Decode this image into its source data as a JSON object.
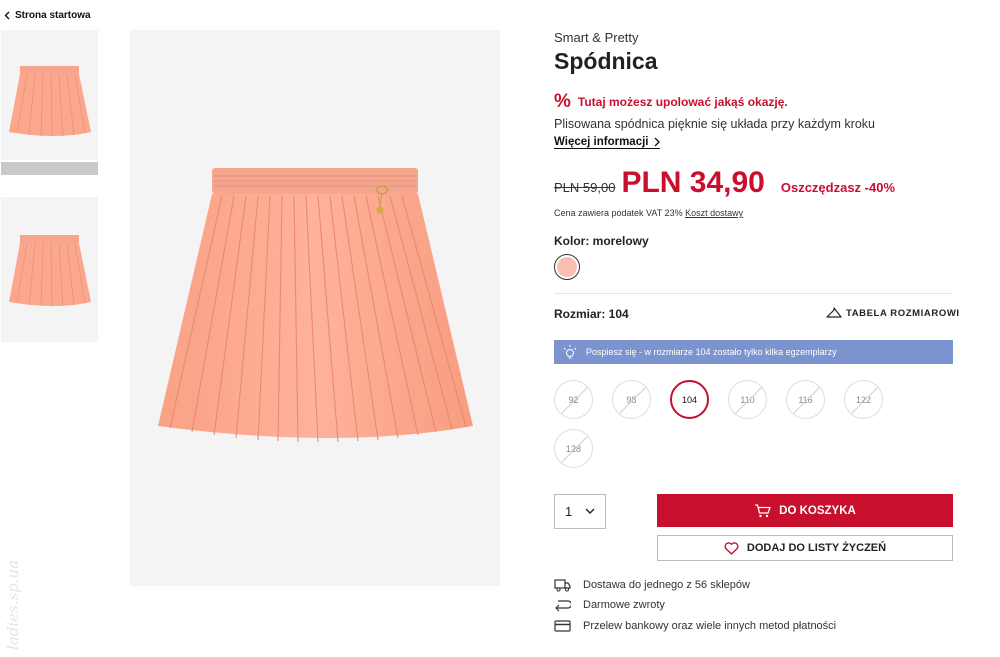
{
  "nav": {
    "back_label": "Strona startowa"
  },
  "watermark": "ladies.sp.ua",
  "product": {
    "brand": "Smart & Pretty",
    "title": "Spódnica",
    "promo_text": "Tutaj możesz upolować jakąś okazję.",
    "promo_icon": "%",
    "description": "Plisowana spódnica pięknie się układa przy każdym kroku",
    "more_info": "Więcej informacji",
    "old_price": "PLN 59,00",
    "new_price": "PLN 34,90",
    "savings": "Oszczędzasz -40%",
    "vat_text": "Cena zawiera podatek VAT 23%",
    "shipping_link": "Koszt dostawy",
    "color_label": "Kolor: morelowy",
    "color_swatch": "#f8c0b2",
    "size_label": "Rozmiar: 104",
    "size_table": "TABELA ROZMIAROWI",
    "stock_banner": "Pospiesz się - w rozmiarze 104 zostało tylko kilka egzemplarzy",
    "sizes": [
      {
        "label": "92",
        "available": false,
        "selected": false
      },
      {
        "label": "98",
        "available": false,
        "selected": false
      },
      {
        "label": "104",
        "available": true,
        "selected": true
      },
      {
        "label": "110",
        "available": false,
        "selected": false
      },
      {
        "label": "116",
        "available": false,
        "selected": false
      },
      {
        "label": "122",
        "available": false,
        "selected": false
      },
      {
        "label": "128",
        "available": false,
        "selected": false
      }
    ],
    "quantity": "1",
    "cart_button": "DO KOSZYKA",
    "wishlist_button": "DODAJ DO LISTY ŻYCZEŃ"
  },
  "info": [
    {
      "icon": "truck-icon",
      "text": "Dostawa do jednego z 56 sklepów"
    },
    {
      "icon": "return-icon",
      "text": "Darmowe zwroty"
    },
    {
      "icon": "card-icon",
      "text": "Przelew bankowy oraz wiele innych metod płatności"
    }
  ],
  "colors": {
    "accent": "#c8102e",
    "banner": "#7b94cf",
    "image_bg": "#f4f4f4",
    "skirt": "#fba78e"
  }
}
